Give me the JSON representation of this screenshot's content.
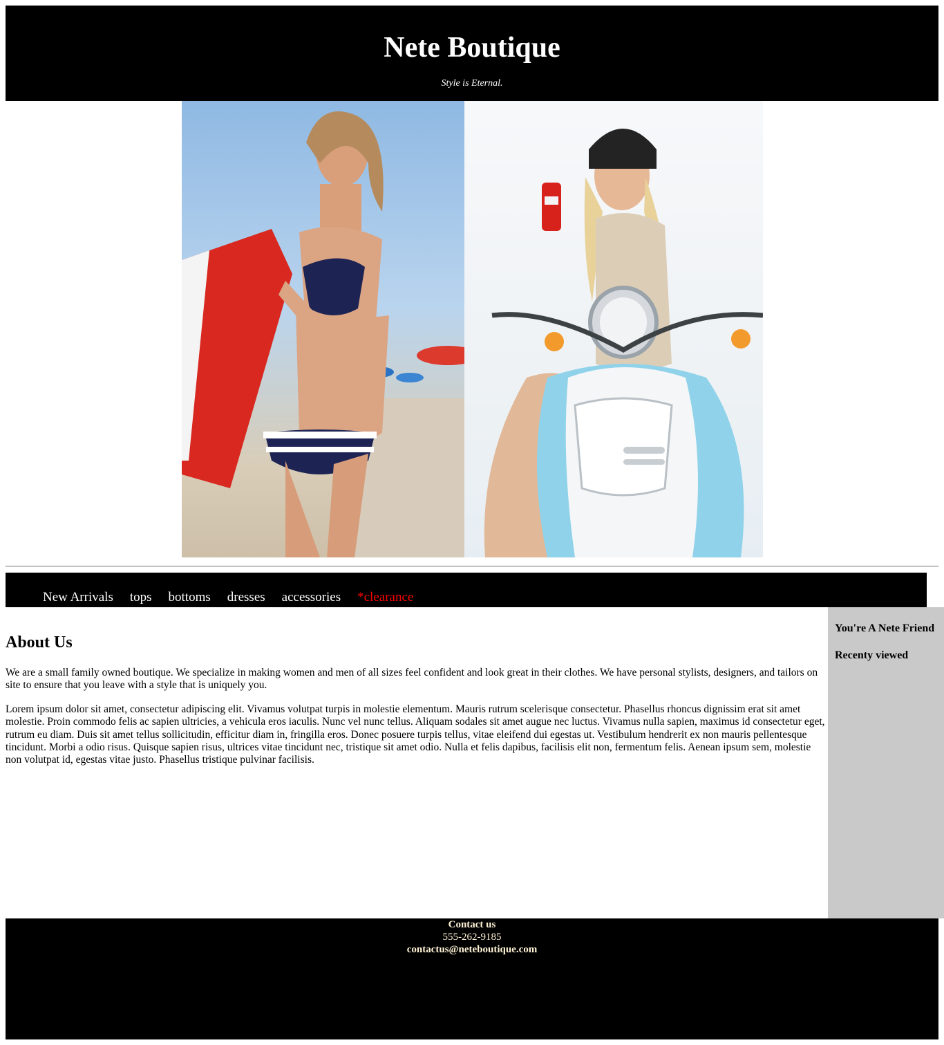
{
  "header": {
    "title": "Nete Boutique",
    "tagline": "Style is Eternal."
  },
  "nav": {
    "items": [
      {
        "label": "New Arrivals"
      },
      {
        "label": "tops"
      },
      {
        "label": "bottoms"
      },
      {
        "label": "dresses"
      },
      {
        "label": "accessories"
      },
      {
        "label": "*clearance"
      }
    ]
  },
  "main": {
    "heading": "About Us",
    "paragraphs": [
      "We are a small family owned boutique. We specialize in making women and men of all sizes feel confident and look great in their clothes. We have personal stylists, designers, and tailors on site to ensure that you leave with a style that is uniquely you.",
      "Lorem ipsum dolor sit amet, consectetur adipiscing elit. Vivamus volutpat turpis in molestie elementum. Mauris rutrum scelerisque consectetur. Phasellus rhoncus dignissim erat sit amet molestie. Proin commodo felis ac sapien ultricies, a vehicula eros iaculis. Nunc vel nunc tellus. Aliquam sodales sit amet augue nec luctus. Vivamus nulla sapien, maximus id consectetur eget, rutrum eu diam. Duis sit amet tellus sollicitudin, efficitur diam in, fringilla eros. Donec posuere turpis tellus, vitae eleifend dui egestas ut. Vestibulum hendrerit ex non mauris pellentesque tincidunt. Morbi a odio risus. Quisque sapien risus, ultrices vitae tincidunt nec, tristique sit amet odio. Nulla et felis dapibus, facilisis elit non, fermentum felis. Aenean ipsum sem, molestie non volutpat id, egestas vitae justo. Phasellus tristique pulvinar facilisis."
    ]
  },
  "aside": {
    "heading1": "You're A Nete Friend",
    "heading2": "Recenty viewed"
  },
  "footer": {
    "contact_label": "Contact us",
    "phone": "555-262-9185",
    "email": "contactus@neteboutique.com"
  },
  "colors": {
    "header_bg": "#000000",
    "clearance": "#ff0000",
    "aside_bg": "#c9c9c9",
    "footer_text": "#fff3d6"
  }
}
